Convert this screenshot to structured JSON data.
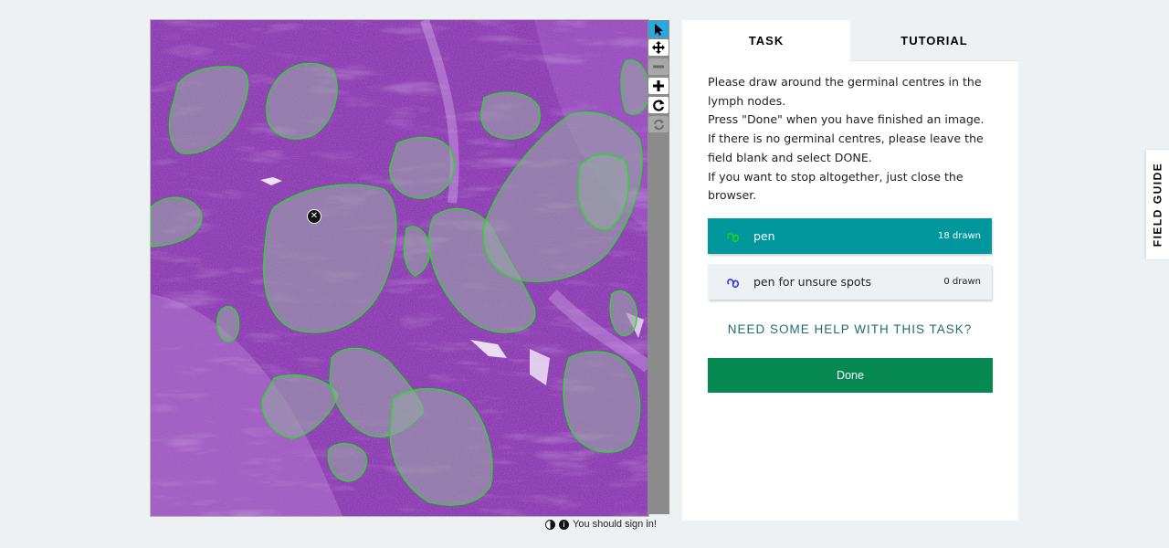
{
  "viewer": {
    "marks": {
      "drawn_count": 18
    },
    "toolbar": [
      {
        "name": "pointer-tool",
        "icon": "cursor-icon",
        "state": "active"
      },
      {
        "name": "pan-tool",
        "icon": "move-icon",
        "state": "enabled"
      },
      {
        "name": "zoom-out-tool",
        "icon": "minus-icon",
        "state": "disabled"
      },
      {
        "name": "zoom-in-tool",
        "icon": "plus-icon",
        "state": "enabled"
      },
      {
        "name": "rotate-tool",
        "icon": "rotate-icon",
        "state": "enabled"
      },
      {
        "name": "reset-tool",
        "icon": "refresh-icon",
        "state": "disabled"
      }
    ],
    "colors": {
      "mark_outline": "#22dd22",
      "stain": "#8a3fb0"
    }
  },
  "footer": {
    "signin_text": "You should sign in!",
    "icons": [
      "contrast-icon",
      "info-icon"
    ]
  },
  "panel": {
    "tabs": [
      {
        "label": "TASK",
        "active": true
      },
      {
        "label": "TUTORIAL",
        "active": false
      }
    ],
    "instructions": [
      "Please draw around the germinal centres in the lymph nodes.",
      "Press \"Done\" when you have finished an image.",
      "If there is no germinal centres, please leave the field blank and select DONE.",
      "If you want to stop altogether, just close the browser."
    ],
    "tools": [
      {
        "label": "pen",
        "count": "18 drawn",
        "selected": true,
        "icon_color": "#1fd01f"
      },
      {
        "label": "pen for unsure spots",
        "count": "0 drawn",
        "selected": false,
        "icon_color": "#2a3fe0"
      }
    ],
    "help_link": "NEED SOME HELP WITH THIS TASK?",
    "done_label": "Done",
    "colors": {
      "selected_tool": "#00979d",
      "done_button": "#078a52",
      "help_link": "#1b6f73"
    }
  },
  "field_guide": {
    "label": "FIELD GUIDE"
  }
}
